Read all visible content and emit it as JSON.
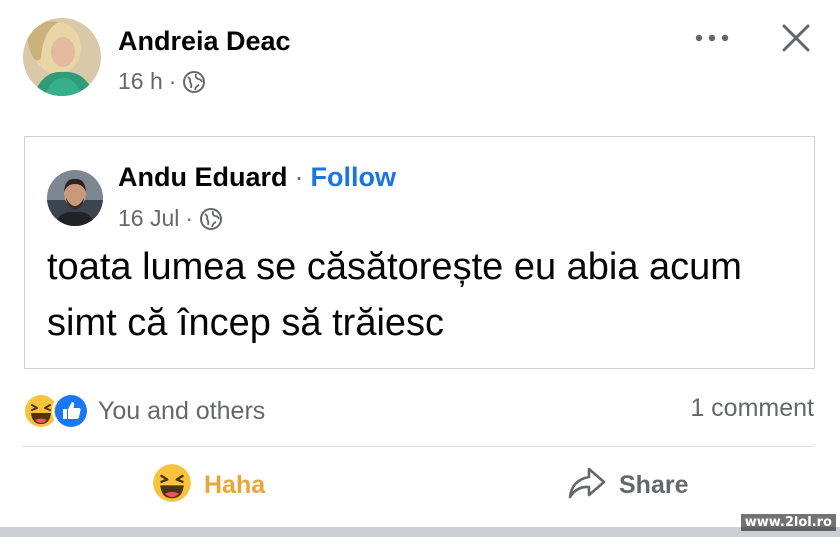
{
  "post": {
    "author": "Andreia Deac",
    "time": "16 h",
    "separator": "·",
    "privacy_icon": "globe-icon"
  },
  "header_actions": {
    "more_icon": "more-icon",
    "close_icon": "close-icon"
  },
  "shared_post": {
    "author": "Andu Eduard",
    "separator": "·",
    "follow_label": "Follow",
    "date": "16 Jul",
    "date_separator": "·",
    "privacy_icon": "globe-icon",
    "text": "toata lumea se căsătorește eu abia acum simt că încep să trăiesc"
  },
  "reactions": {
    "icons": [
      "haha-icon",
      "like-icon"
    ],
    "summary": "You and others",
    "comment_count": "1 comment"
  },
  "actions": {
    "haha_label": "Haha",
    "share_label": "Share"
  },
  "watermark": "www.2lol.ro",
  "colors": {
    "accent_blue": "#1b74e4",
    "haha_yellow": "#e9a53b",
    "meta_gray": "#65676b"
  }
}
